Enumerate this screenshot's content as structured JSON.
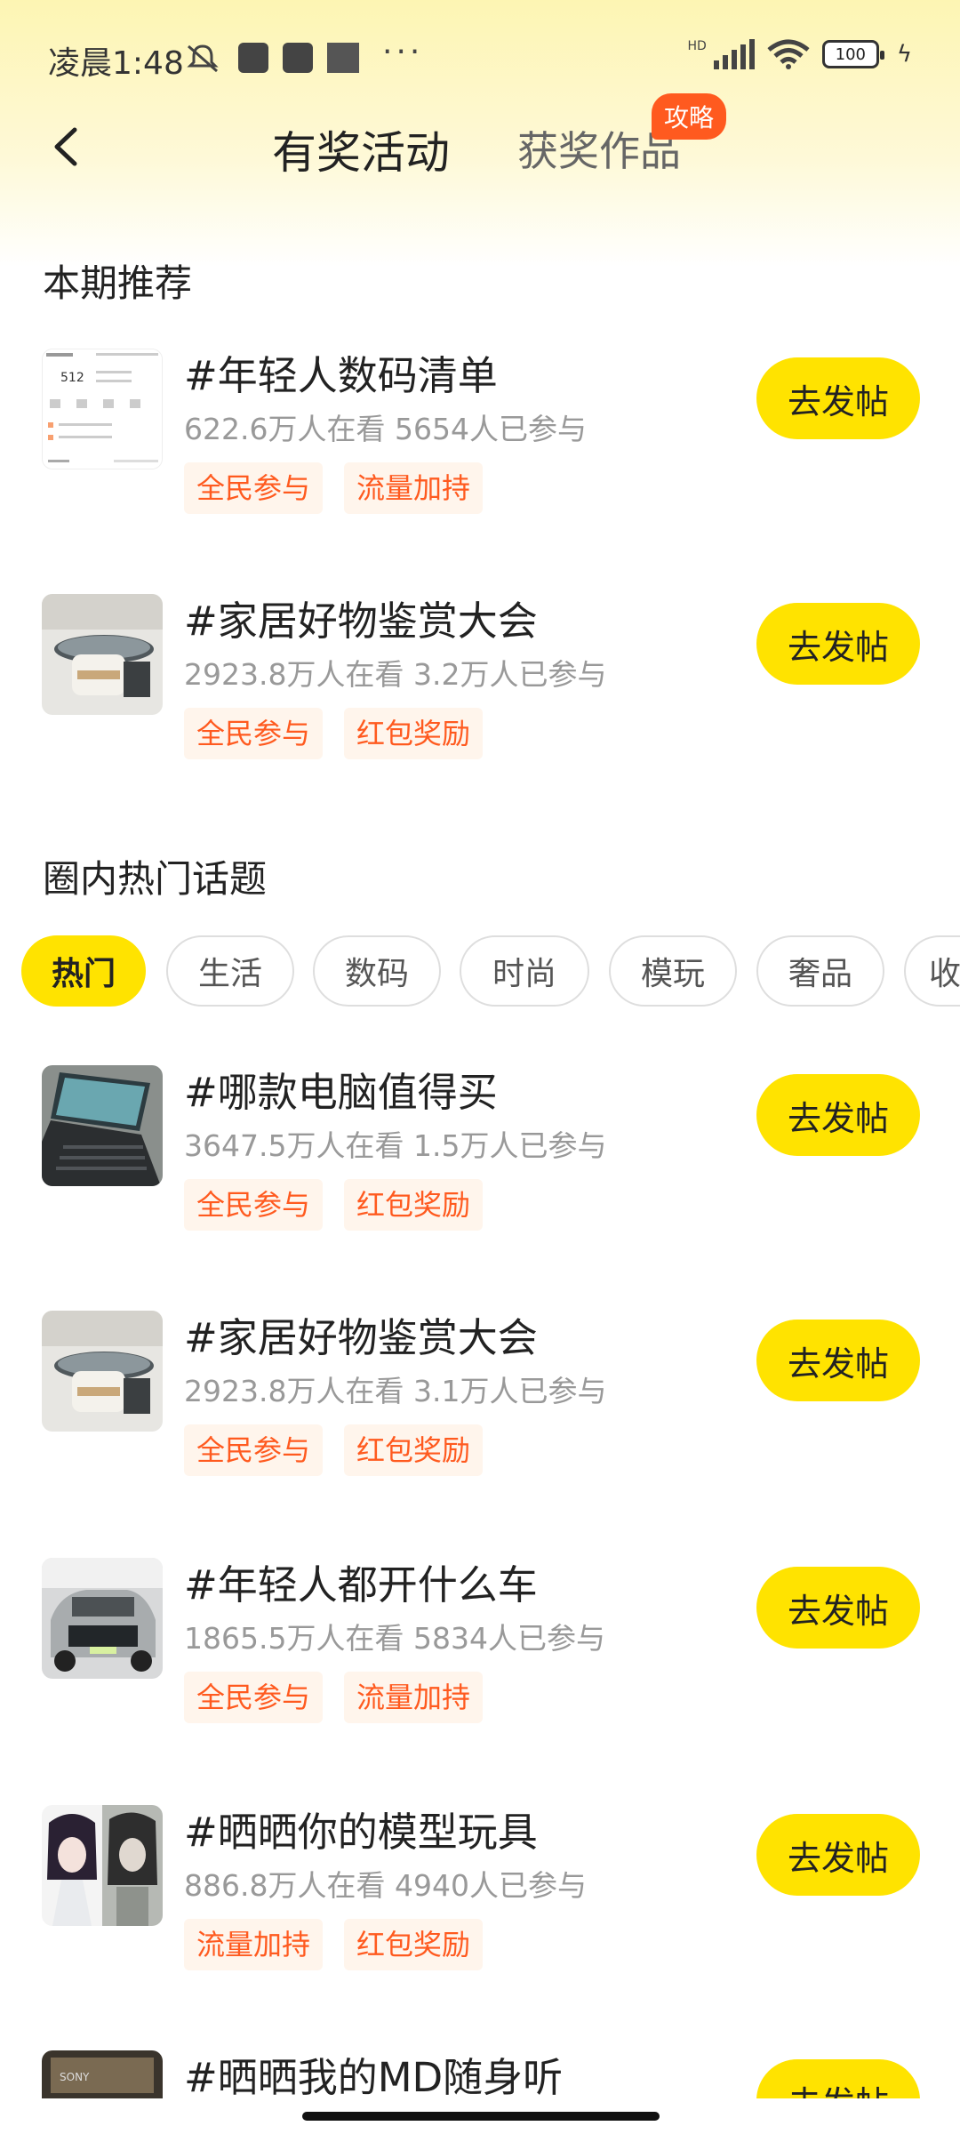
{
  "status_bar": {
    "time": "凌晨1:48",
    "network": "HD",
    "battery": "100",
    "more": "···"
  },
  "header": {
    "title": "有奖活动",
    "tab_awards": "获奖作品",
    "badge": "攻略"
  },
  "featured": {
    "title": "本期推荐",
    "items": [
      {
        "title": "#年轻人数码清单",
        "stats": "622.6万人在看 5654人已参与",
        "tags": [
          "全民参与",
          "流量加持"
        ],
        "button": "去发帖",
        "thumb_text": "512"
      },
      {
        "title": "#家居好物鉴赏大会",
        "stats": "2923.8万人在看 3.2万人已参与",
        "tags": [
          "全民参与",
          "红包奖励"
        ],
        "button": "去发帖"
      }
    ]
  },
  "hot": {
    "title": "圈内热门话题",
    "chips": [
      "热门",
      "生活",
      "数码",
      "时尚",
      "模玩",
      "奢品",
      "收"
    ],
    "items": [
      {
        "title": "#哪款电脑值得买",
        "stats": "3647.5万人在看 1.5万人已参与",
        "tags": [
          "全民参与",
          "红包奖励"
        ],
        "button": "去发帖"
      },
      {
        "title": "#家居好物鉴赏大会",
        "stats": "2923.8万人在看 3.1万人已参与",
        "tags": [
          "全民参与",
          "红包奖励"
        ],
        "button": "去发帖"
      },
      {
        "title": "#年轻人都开什么车",
        "stats": "1865.5万人在看 5834人已参与",
        "tags": [
          "全民参与",
          "流量加持"
        ],
        "button": "去发帖"
      },
      {
        "title": "#晒晒你的模型玩具",
        "stats": "886.8万人在看 4940人已参与",
        "tags": [
          "流量加持",
          "红包奖励"
        ],
        "button": "去发帖"
      },
      {
        "title": "#晒晒我的MD随身听",
        "stats": "",
        "tags": [],
        "button": "去发帖"
      }
    ]
  },
  "colors": {
    "accent": "#ffe300",
    "tag_text": "#ff5a1f",
    "tag_bg": "#fff5ec",
    "badge": "#ff5a1f"
  }
}
